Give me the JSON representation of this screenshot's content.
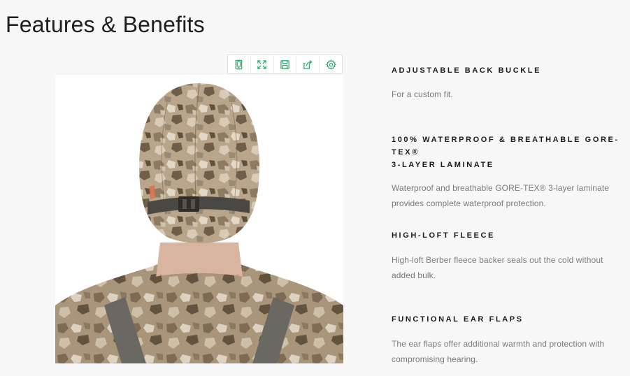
{
  "page": {
    "title": "Features & Benefits"
  },
  "toolbar": {
    "buttons": [
      {
        "icon": "tablet-icon"
      },
      {
        "icon": "expand-icon"
      },
      {
        "icon": "save-icon"
      },
      {
        "icon": "share-icon"
      },
      {
        "icon": "gear-icon"
      }
    ],
    "accent_color": "#2fa56b"
  },
  "image": {
    "subject": "camo-beanie-back-view"
  },
  "features": [
    {
      "title": "ADJUSTABLE BACK BUCKLE",
      "description": "For a custom fit."
    },
    {
      "title_line1": "100% WATERPROOF & BREATHABLE GORE-TEX®",
      "title_line2": "3-LAYER LAMINATE",
      "description_line1": "Waterproof and breathable GORE-TEX® 3-layer laminate",
      "description_line2": "provides complete waterproof protection."
    },
    {
      "title": "HIGH-LOFT FLEECE",
      "description_line1": "High-loft Berber fleece backer seals out the cold without",
      "description_line2": "added bulk."
    },
    {
      "title": "FUNCTIONAL EAR FLAPS",
      "description_line1": "The ear flaps offer additional warmth and protection with",
      "description_line2": "compromising hearing."
    }
  ]
}
